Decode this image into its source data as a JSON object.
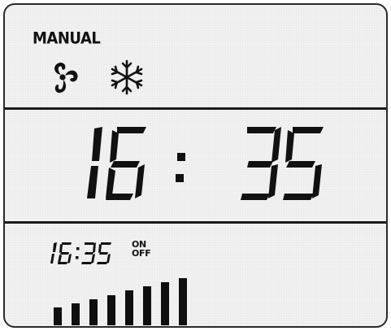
{
  "display": {
    "mode_label": "MANUAL",
    "icons": {
      "fan": "fan-icon",
      "snowflake": "snowflake-icon"
    },
    "main_time": {
      "hours": "16",
      "colon": ":",
      "minutes": "35"
    },
    "timer": {
      "time": "16:35",
      "on_label": "ON",
      "off_label": "OFF"
    },
    "fan_speed_level": {
      "active_bars": 8,
      "total_bars": 8
    }
  },
  "colors": {
    "panel_background": "#f2f2f2",
    "segment": "#111111",
    "border": "#2a2a2a"
  }
}
